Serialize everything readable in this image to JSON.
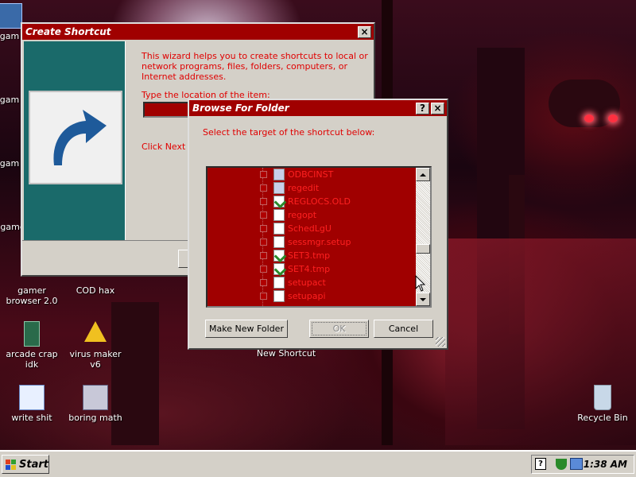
{
  "desktop": {
    "icons": [
      {
        "label": "gam"
      },
      {
        "label": "gam"
      },
      {
        "label": "gam"
      },
      {
        "label": "game"
      },
      {
        "label": "gamer browser 2.0"
      },
      {
        "label": "COD hax"
      },
      {
        "label": "arcade crap idk"
      },
      {
        "label": "virus maker v6"
      },
      {
        "label": "New Shortcut"
      },
      {
        "label": "write shit"
      },
      {
        "label": "boring math"
      },
      {
        "label": "Recycle Bin"
      }
    ]
  },
  "create_shortcut": {
    "title": "Create Shortcut",
    "close_glyph": "×",
    "intro": "This wizard helps you to create shortcuts to local or network programs, files, folders, computers, or Internet addresses.",
    "location_label": "Type the location of the item:",
    "location_value": "",
    "next_hint": "Click Next to"
  },
  "browse_folder": {
    "title": "Browse For Folder",
    "help_glyph": "?",
    "close_glyph": "×",
    "prompt": "Select the target of the shortcut below:",
    "items": [
      {
        "label": "ODBCINST",
        "icon": "gear"
      },
      {
        "label": "regedit",
        "icon": "gear"
      },
      {
        "label": "REGLOCS.OLD",
        "icon": "check"
      },
      {
        "label": "regopt",
        "icon": "file"
      },
      {
        "label": "SchedLgU",
        "icon": "file"
      },
      {
        "label": "sessmgr.setup",
        "icon": "file"
      },
      {
        "label": "SET3.tmp",
        "icon": "check"
      },
      {
        "label": "SET4.tmp",
        "icon": "check"
      },
      {
        "label": "setupact",
        "icon": "file"
      },
      {
        "label": "setupapi",
        "icon": "file"
      }
    ],
    "make_new_folder": "Make New Folder",
    "ok": "OK",
    "cancel": "Cancel"
  },
  "taskbar": {
    "start_label": "Start",
    "clock": "1:38 AM",
    "help_glyph": "?"
  },
  "colors": {
    "accent": "#a00000",
    "list_bg": "#a00000",
    "text_red": "#e00000"
  }
}
